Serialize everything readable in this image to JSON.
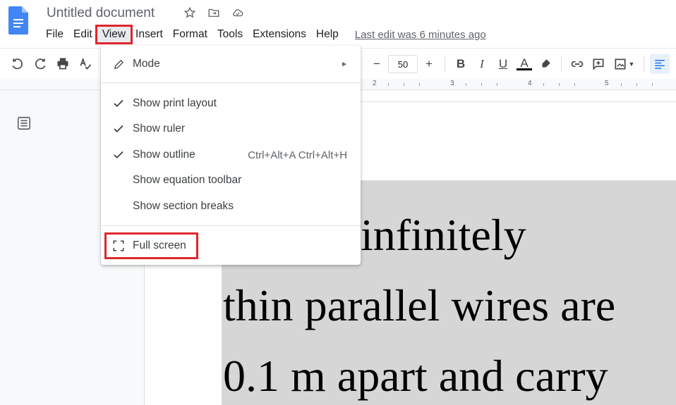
{
  "document": {
    "title": "Untitled document",
    "last_edit": "Last edit was 6 minutes ago",
    "content_lines": [
      "straight infinitely",
      "thin parallel wires are",
      "0.1 m apart and carry"
    ]
  },
  "menubar": {
    "items": [
      "File",
      "Edit",
      "View",
      "Insert",
      "Format",
      "Tools",
      "Extensions",
      "Help"
    ],
    "active": "View"
  },
  "toolbar": {
    "font_size": "50",
    "buttons": [
      "undo-icon",
      "redo-icon",
      "print-icon",
      "spellcheck-icon",
      "decrease-size-icon",
      "increase-size-icon",
      "bold-icon",
      "italic-icon",
      "underline-icon",
      "text-color-icon",
      "highlight-icon",
      "link-icon",
      "comment-icon",
      "image-icon",
      "align-left-icon"
    ]
  },
  "ruler": {
    "labels": [
      "2",
      "3",
      "4",
      "5"
    ]
  },
  "view_menu": {
    "mode": "Mode",
    "items": [
      {
        "label": "Show print layout",
        "checked": true,
        "shortcut": ""
      },
      {
        "label": "Show ruler",
        "checked": true,
        "shortcut": ""
      },
      {
        "label": "Show outline",
        "checked": true,
        "shortcut": "Ctrl+Alt+A Ctrl+Alt+H"
      },
      {
        "label": "Show equation toolbar",
        "checked": false,
        "shortcut": ""
      },
      {
        "label": "Show section breaks",
        "checked": false,
        "shortcut": ""
      }
    ],
    "full_screen": "Full screen"
  },
  "colors": {
    "accent_red": "#e0262c",
    "docs_blue": "#4285f4",
    "selection_gray": "#d6d6d6"
  }
}
